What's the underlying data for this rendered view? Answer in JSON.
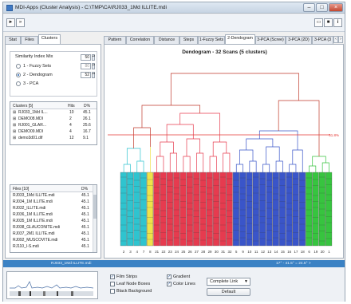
{
  "window": {
    "title": "MDI-Apps (Cluster Analysis) - C:\\TMP\\CA\\RJ033_1Md ILLITE.mdi",
    "minimize_label": "–",
    "maximize_label": "□",
    "close_label": "×"
  },
  "toolbar": {
    "buttons": [
      "play-icon",
      "forward-icon",
      "window-icon",
      "page-icon",
      "info-icon"
    ]
  },
  "left_tabs": [
    {
      "label": "Stat",
      "active": false
    },
    {
      "label": "Files",
      "active": false
    },
    {
      "label": "Clusters",
      "active": true
    }
  ],
  "similarity": {
    "title": "Similarity Index Mix",
    "top_value": "50",
    "options": [
      {
        "label": "1 - Fuzzy Sets",
        "value": "80",
        "selected": false
      },
      {
        "label": "2 - Dendogram",
        "value": "52",
        "selected": true
      },
      {
        "label": "3 - PCA",
        "value": "",
        "selected": false
      }
    ]
  },
  "clusters_list": {
    "header": {
      "name": "Clusters [5]",
      "hits": "Hits",
      "pct": "D%"
    },
    "rows": [
      {
        "name": "RJ033_1Md IL...",
        "hits": "10",
        "pct": "45.1"
      },
      {
        "name": "DEMO08.MDI",
        "hits": "2",
        "pct": "26.1"
      },
      {
        "name": "RJ001_GLAR...",
        "hits": "4",
        "pct": "25.6"
      },
      {
        "name": "DEMO09.MDI",
        "hits": "4",
        "pct": "16.7"
      },
      {
        "name": "demo3d01.dif",
        "hits": "12",
        "pct": "9.1"
      }
    ]
  },
  "files_list": {
    "header": {
      "name": "Files [10]",
      "pct": "D%"
    },
    "rows": [
      {
        "name": "RJ033_1Md ILLITE.mdi",
        "pct": "45.1"
      },
      {
        "name": "RJ034_1M ILLITE.mdi",
        "pct": "45.1"
      },
      {
        "name": "RJ032_ILLITE.mdi",
        "pct": "45.1"
      },
      {
        "name": "RJ036_1M ILLITE.mdi",
        "pct": "45.1"
      },
      {
        "name": "RJ035_1M ILLITE.mdi",
        "pct": "45.1"
      },
      {
        "name": "RJ038_GLAUCONITE.mdi",
        "pct": "45.1"
      },
      {
        "name": "RJ037_2M1 ILLITE.mdi",
        "pct": "45.1"
      },
      {
        "name": "RJ092_MUSCOVITE.mdi",
        "pct": "45.1"
      },
      {
        "name": "RJ110_I-S.mdi",
        "pct": "45.1"
      }
    ]
  },
  "right_tabs": [
    {
      "label": "Pattern",
      "active": false
    },
    {
      "label": "Correlation",
      "active": false
    },
    {
      "label": "Distance",
      "active": false
    },
    {
      "label": "Steps",
      "active": false
    },
    {
      "label": "1-Fuzzy Sets",
      "active": false
    },
    {
      "label": "2-Dendogram",
      "active": true
    },
    {
      "label": "3-PCA (Scree)",
      "active": false
    },
    {
      "label": "3-PCA (2D)",
      "active": false
    },
    {
      "label": "3-PCA (3",
      "active": false
    }
  ],
  "chart_data": {
    "type": "dendrogram",
    "title": "Dendogram - 32 Scans (5 clusters)",
    "cutoff_label": "51.8%",
    "leaf_order": [
      2,
      3,
      4,
      7,
      8,
      21,
      22,
      23,
      24,
      25,
      26,
      27,
      28,
      29,
      30,
      31,
      32,
      5,
      9,
      10,
      11,
      12,
      13,
      14,
      15,
      16,
      17,
      18,
      6,
      19,
      20,
      1
    ],
    "clusters": [
      {
        "color": "#2fc4cf",
        "leaves": [
          2,
          3,
          4,
          7
        ]
      },
      {
        "color": "#efe24a",
        "leaves": [
          8
        ]
      },
      {
        "color": "#e63b4f",
        "leaves": [
          21,
          22,
          23,
          24,
          25,
          26,
          27,
          28,
          29,
          30,
          31,
          32
        ]
      },
      {
        "color": "#3a55c9",
        "leaves": [
          5,
          9,
          10,
          11,
          12,
          13,
          14,
          15,
          16,
          17,
          18
        ]
      },
      {
        "color": "#37c43f",
        "leaves": [
          6,
          19,
          20,
          1
        ]
      }
    ]
  },
  "status": {
    "left": "RJ033_1Md ILLITE.mdi",
    "right": "17° - 41.5° = 24.5° >"
  },
  "options": {
    "checkboxes": [
      {
        "label": "Film Strips",
        "checked": true
      },
      {
        "label": "Leaf Node Boxes",
        "checked": false
      },
      {
        "label": "Black Background",
        "checked": false
      },
      {
        "label": "Gradient",
        "checked": true
      },
      {
        "label": "Color Lines",
        "checked": true
      }
    ],
    "linkage": "Complete Link",
    "default_label": "Default"
  },
  "colors": {
    "statusbar": "#3b82c4",
    "cutoff_line": "#e53935",
    "tree_lines": "#c0392b"
  }
}
